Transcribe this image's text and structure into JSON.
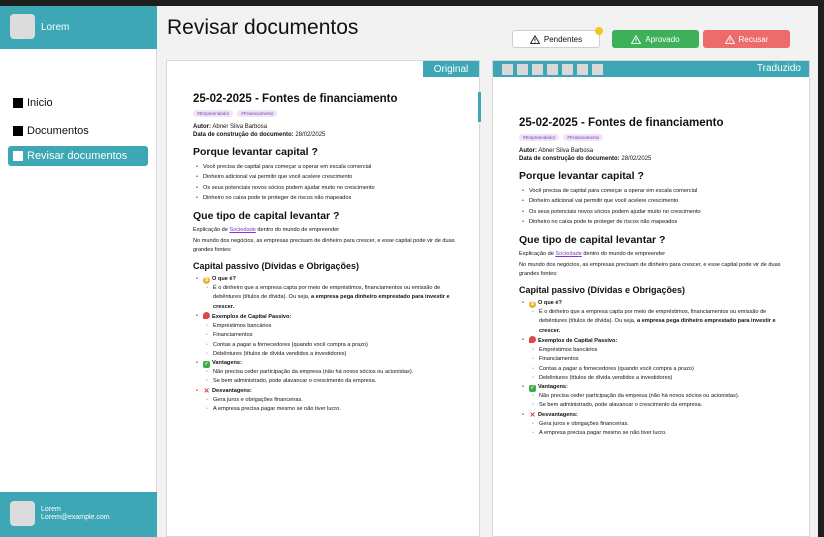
{
  "sidebar": {
    "brand": "Lorem",
    "nav": [
      {
        "label": "Inicio"
      },
      {
        "label": "Documentos"
      },
      {
        "label": "Revisar documentos"
      }
    ],
    "user": {
      "name": "Lorem",
      "email": "Lorem@example.com"
    }
  },
  "header": {
    "title": "Revisar documentos",
    "pending_label": "Pendentes",
    "approve_label": "Aprovado",
    "reject_label": "Recusar"
  },
  "panels": {
    "original_label": "Original",
    "translated_label": "Traduzido"
  },
  "document": {
    "title": "25-02-2025 - Fontes de financiamento",
    "tags": [
      "#Empreendedor",
      "#Financiamento"
    ],
    "author_label": "Autor:",
    "author": "Abner Silva Barbosa",
    "date_label": "Data de construção do documento:",
    "date": "28/02/2025",
    "h_why": "Porque levantar capital ?",
    "why_items": [
      "Você precisa de capital para começar a operar em escala comercial",
      "Dinheiro adicional vai permitir que você acelere crescimento",
      "Os seus potenciais novos sócios podem ajudar muito no crescimento",
      "Dinheiro no caixa pode te proteger de riscos não mapeados"
    ],
    "h_type": "Que tipo de capital levantar ?",
    "intro_before": "Explicação de ",
    "intro_link": "Sociedade",
    "intro_after": " dentro do mundo de empreender",
    "paragraph": "No mundo dos negócios, as empresas precisam de dinheiro para crescer, e esse capital pode vir de duas grandes fontes:",
    "h_passive": "Capital passivo (Dívidas e Obrigações)",
    "what_label": "O que é?",
    "what_text": "É o dinheiro que a empresa capta por meio de empréstimos, financiamentos ou emissão de debêntures (títulos de dívida). Ou seja, ",
    "what_bold": "a empresa pega dinheiro emprestado para investir e crescer.",
    "examples_label": "Exemplos de Capital Passivo:",
    "examples": [
      "Empréstimos bancários",
      "Financiamentos",
      "Contas a pagar a fornecedores (quando você compra a prazo)",
      "Debêntures (títulos de dívida vendidos a investidores)"
    ],
    "advantages_label": "Vantagens:",
    "advantages": [
      "Não precisa ceder participação da empresa (não há novos sócios ou acionistas).",
      "Se bem administrado, pode alavancar o crescimento da empresa."
    ],
    "disadvantages_label": "Desvantagens:",
    "disadvantages": [
      "Gera juros e obrigações financeiras.",
      "A empresa precisa pagar mesmo se não tiver lucro."
    ]
  },
  "icons": {
    "warning": "warning-triangle-icon",
    "pending_dot_color": "#f3c623",
    "accent": "#3ea7b5",
    "approve_color": "#3fb05a",
    "reject_color": "#ee6b6b"
  }
}
